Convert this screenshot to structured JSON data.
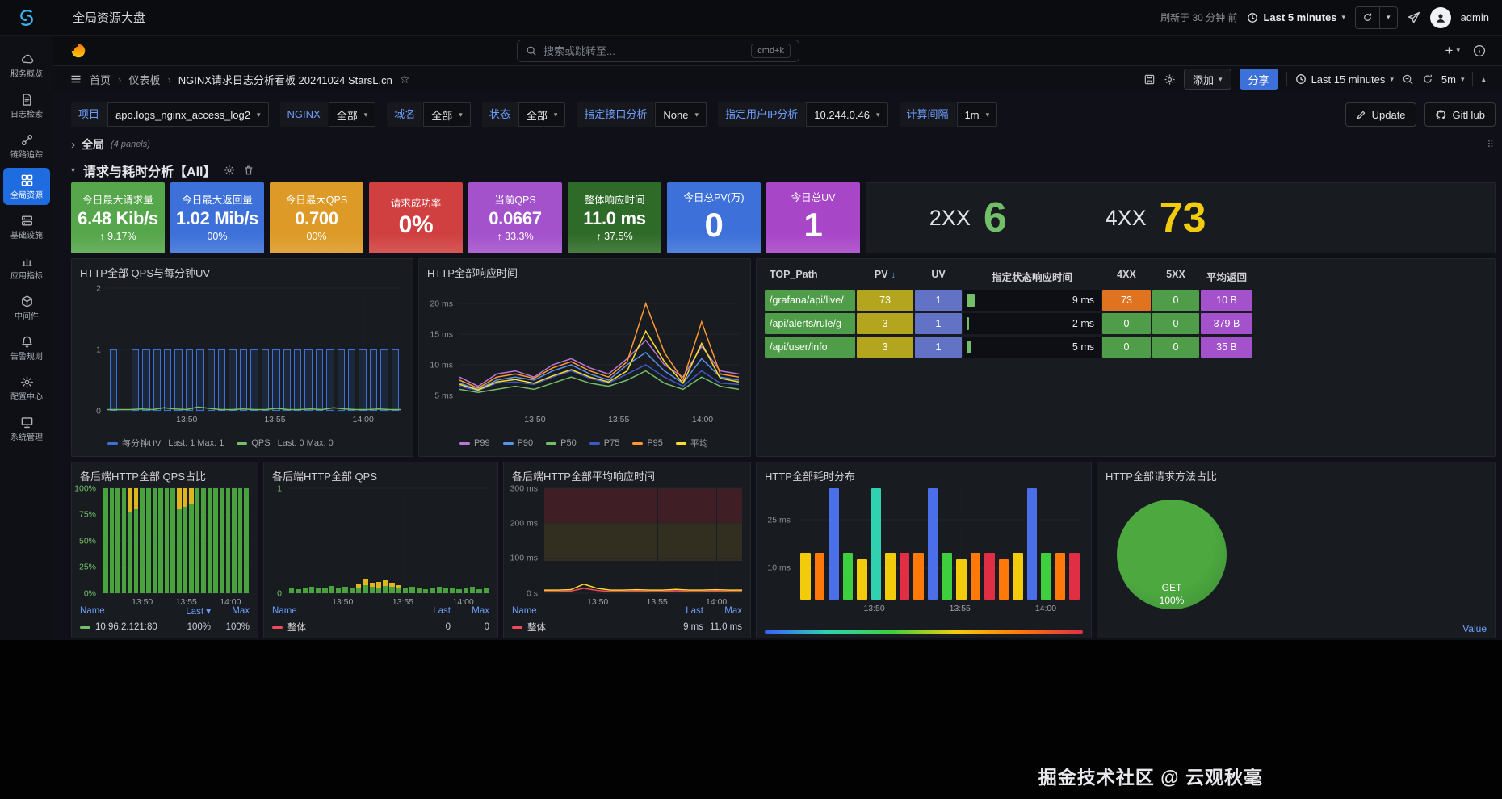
{
  "topbar": {
    "title": "全局资源大盘",
    "refreshed_note": "刷新于 30 分钟 前",
    "time_range": "Last 5 minutes",
    "user": "admin"
  },
  "sidebar": {
    "active_color": "#1f6be0",
    "items": [
      {
        "id": "service-overview",
        "label": "服务概览",
        "icon": "cloud-icon"
      },
      {
        "id": "log-search",
        "label": "日志检索",
        "icon": "log-doc-icon"
      },
      {
        "id": "trace",
        "label": "链路追踪",
        "icon": "trace-icon"
      },
      {
        "id": "global-resource",
        "label": "全局资源",
        "icon": "dashboard-icon",
        "active": true
      },
      {
        "id": "infrastructure",
        "label": "基础设施",
        "icon": "server-icon"
      },
      {
        "id": "app-metrics",
        "label": "应用指标",
        "icon": "metrics-icon"
      },
      {
        "id": "middleware",
        "label": "中间件",
        "icon": "cube-icon"
      },
      {
        "id": "alert-rules",
        "label": "告警规则",
        "icon": "bell-icon"
      },
      {
        "id": "config-center",
        "label": "配置中心",
        "icon": "gear-icon"
      },
      {
        "id": "system-admin",
        "label": "系统管理",
        "icon": "monitor-icon"
      }
    ]
  },
  "grafana_nav": {
    "search_placeholder": "搜索或跳转至...",
    "shortcut": "cmd+k"
  },
  "breadcrumbs": {
    "home": "首页",
    "section": "仪表板",
    "page": "NGINX请求日志分析看板 20241024 StarsL.cn"
  },
  "toolbar": {
    "add_label": "添加",
    "share_label": "分享",
    "time_range": "Last 15 minutes",
    "refresh_interval": "5m"
  },
  "filters": {
    "items": [
      {
        "label": "项目",
        "value": "apo.logs_nginx_access_log2"
      },
      {
        "label": "NGINX",
        "value": "全部"
      },
      {
        "label": "域名",
        "value": "全部"
      },
      {
        "label": "状态",
        "value": "全部"
      },
      {
        "label": "指定接口分析",
        "value": "None"
      },
      {
        "label": "指定用户IP分析",
        "value": "10.244.0.46"
      },
      {
        "label": "计算间隔",
        "value": "1m"
      }
    ],
    "update_label": "Update",
    "github_label": "GitHub"
  },
  "rows": {
    "global_title": "全局",
    "global_note": "(4 panels)",
    "section_title": "请求与耗时分析【All】"
  },
  "stats": [
    {
      "title": "今日最大请求量",
      "value": "6.48 Kib/s",
      "delta": "↑ 9.17%",
      "bg": "#56a64b"
    },
    {
      "title": "今日最大返回量",
      "value": "1.02 Mib/s",
      "delta": "00%",
      "bg": "#3d71d9"
    },
    {
      "title": "今日最大QPS",
      "value": "0.700",
      "delta": "00%",
      "bg": "#dd9a26"
    },
    {
      "title": "请求成功率",
      "value": "0%",
      "size": "lg",
      "bg": "#d04040"
    },
    {
      "title": "当前QPS",
      "value": "0.0667",
      "delta": "↑ 33.3%",
      "bg": "#a352cc"
    },
    {
      "title": "整体响应时间",
      "value": "11.0 ms",
      "delta": "↑ 37.5%",
      "bg": "#2f6b28"
    },
    {
      "title": "今日总PV(万)",
      "value": "0",
      "size": "big",
      "bg": "#3d71d9"
    },
    {
      "title": "今日总UV",
      "value": "1",
      "size": "big",
      "bg": "#a846c8"
    }
  ],
  "status_stats": [
    {
      "label": "2XX",
      "value": "6",
      "color": "#73bf69"
    },
    {
      "label": "4XX",
      "value": "73",
      "color": "#f2cc0c"
    }
  ],
  "charts": {
    "qps_uv": {
      "title": "HTTP全部 QPS与每分钟UV",
      "ymax": 2,
      "y_grid": [
        {
          "f": 0,
          "label": "0"
        },
        {
          "f": 0.5,
          "label": "1"
        },
        {
          "f": 1,
          "label": "2"
        }
      ],
      "x_grid": [
        {
          "f": 0.27,
          "label": "13:50"
        },
        {
          "f": 0.57,
          "label": "13:55"
        },
        {
          "f": 0.87,
          "label": "14:00"
        }
      ],
      "bar_color": "#3d71d9",
      "bars": [
        1,
        0,
        1,
        1,
        1,
        1,
        1,
        1,
        1,
        1,
        1,
        1,
        1,
        1,
        1,
        1,
        1,
        1,
        1,
        1,
        1,
        1,
        1,
        1,
        1,
        1,
        1
      ],
      "line_color": "#73bf69",
      "line": [
        0.02,
        0.02,
        0.02,
        0.03,
        0.02,
        0.05,
        0.03,
        0.02,
        0.06,
        0.04,
        0.02,
        0.02,
        0.03,
        0.02,
        0.02,
        0.04,
        0.02,
        0.02,
        0.03,
        0.02,
        0.05,
        0.03,
        0.02,
        0.02,
        0.03,
        0.02,
        0.02
      ],
      "legend": [
        {
          "label": "每分钟UV",
          "color": "#3d71d9",
          "stats": "Last: 1   Max: 1"
        },
        {
          "label": "QPS",
          "color": "#73bf69",
          "stats": "Last: 0   Max: 0"
        }
      ]
    },
    "resp_time": {
      "title": "HTTP全部响应时间",
      "ymin": 2.5,
      "ymax": 22.5,
      "y_grid": [
        {
          "f": 0.125,
          "label": "5 ms"
        },
        {
          "f": 0.375,
          "label": "10 ms"
        },
        {
          "f": 0.625,
          "label": "15 ms"
        },
        {
          "f": 0.875,
          "label": "20 ms"
        }
      ],
      "x_grid": [
        {
          "f": 0.27,
          "label": "13:50"
        },
        {
          "f": 0.57,
          "label": "13:55"
        },
        {
          "f": 0.87,
          "label": "14:00"
        }
      ],
      "series": [
        {
          "name": "P99",
          "color": "#b877d9",
          "values": [
            8,
            6.5,
            8.5,
            9,
            8,
            10,
            11,
            9.5,
            8.5,
            11,
            14,
            10,
            8,
            13,
            9,
            8.5
          ]
        },
        {
          "name": "P90",
          "color": "#5794f2",
          "values": [
            7,
            6,
            7.5,
            8,
            7.5,
            9,
            10,
            8.5,
            7.5,
            10,
            12,
            9,
            7,
            11,
            8,
            7.5
          ]
        },
        {
          "name": "P50",
          "color": "#73bf69",
          "values": [
            6,
            5.5,
            6,
            6.5,
            6,
            7,
            8,
            7,
            6.5,
            7.5,
            9,
            7,
            6,
            8,
            6.5,
            6
          ]
        },
        {
          "name": "P75",
          "color": "#3d58c9",
          "values": [
            6.5,
            5.8,
            7,
            7.2,
            6.8,
            8,
            9,
            7.8,
            7,
            8.5,
            10,
            8,
            6.5,
            9,
            7,
            6.8
          ]
        },
        {
          "name": "P95",
          "color": "#ff9830",
          "values": [
            7.5,
            6.2,
            8,
            8.5,
            7.8,
            9.5,
            10.5,
            9,
            8,
            10.5,
            20,
            12,
            7.5,
            17,
            8.5,
            8
          ]
        },
        {
          "name": "平均",
          "color": "#fade2a",
          "values": [
            6.8,
            5.9,
            7.2,
            7.6,
            7,
            8.2,
            9.2,
            8,
            7.2,
            9,
            15.5,
            10.5,
            7,
            13.5,
            7.8,
            7.2
          ]
        }
      ]
    },
    "top_table": {
      "headers": [
        "TOP_Path",
        "PV",
        "UV",
        "指定状态响应时间",
        "4XX",
        "5XX",
        "平均返回"
      ],
      "sorted_by": "PV",
      "path_bg": "#4f9d48",
      "pv_bg": "#b3a51d",
      "uv_bg": "#6272c4",
      "avg_bg": "#a352cc",
      "ok_bg": "#4f9d48",
      "warn_bg": "#e0731f",
      "gauge_color": "#73bf69",
      "rows": [
        {
          "path": "/grafana/api/live/",
          "pv": "73",
          "uv": "1",
          "resp": "9 ms",
          "resp_f": 0.06,
          "xx4": "73",
          "xx4_warn": true,
          "xx5": "0",
          "avg": "10 B"
        },
        {
          "path": "/api/alerts/rule/g",
          "pv": "3",
          "uv": "1",
          "resp": "2 ms",
          "resp_f": 0.02,
          "xx4": "0",
          "xx4_warn": false,
          "xx5": "0",
          "avg": "379 B"
        },
        {
          "path": "/api/user/info",
          "pv": "3",
          "uv": "1",
          "resp": "5 ms",
          "resp_f": 0.035,
          "xx4": "0",
          "xx4_warn": false,
          "xx5": "0",
          "avg": "35 B"
        }
      ]
    },
    "backend_ratio": {
      "title": "各后端HTTP全部 QPS占比",
      "axis_color": "#73bf69",
      "y_grid": [
        {
          "f": 0,
          "label": "0%"
        },
        {
          "f": 0.25,
          "label": "25%"
        },
        {
          "f": 0.5,
          "label": "50%"
        },
        {
          "f": 0.75,
          "label": "75%"
        },
        {
          "f": 1,
          "label": "100%"
        }
      ],
      "x_grid": [
        {
          "f": 0.27,
          "label": "13:50"
        },
        {
          "f": 0.57,
          "label": "13:55"
        },
        {
          "f": 0.87,
          "label": "14:00"
        }
      ],
      "green_color": "#4aa23f",
      "yellow_color": "#ddb620",
      "yellow": [
        0,
        0,
        0,
        0,
        0.22,
        0.2,
        0,
        0,
        0,
        0,
        0,
        0,
        0.2,
        0.18,
        0.15,
        0,
        0,
        0,
        0,
        0,
        0,
        0,
        0,
        0
      ],
      "table": {
        "headers": [
          "Name",
          "Last",
          "Max"
        ],
        "sorted": "Last",
        "rows": [
          {
            "name": "10.96.2.121:80",
            "color": "#73bf69",
            "last": "100%",
            "max": "100%"
          }
        ]
      }
    },
    "backend_qps": {
      "title": "各后端HTTP全部 QPS",
      "axis_color": "#73bf69",
      "y_grid": [
        {
          "f": 0,
          "label": "0"
        },
        {
          "f": 1,
          "label": "1"
        }
      ],
      "x_grid": [
        {
          "f": 0.27,
          "label": "13:50"
        },
        {
          "f": 0.57,
          "label": "13:55"
        },
        {
          "f": 0.87,
          "label": "14:00"
        }
      ],
      "green_color": "#4aa23f",
      "yellow_color": "#ddb620",
      "green": [
        0.05,
        0.04,
        0.05,
        0.06,
        0.05,
        0.05,
        0.07,
        0.05,
        0.06,
        0.05,
        0.05,
        0.08,
        0.06,
        0.05,
        0.07,
        0.06,
        0.05,
        0.05,
        0.06,
        0.05,
        0.04,
        0.05,
        0.06,
        0.05,
        0.05,
        0.04,
        0.05,
        0.06,
        0.04,
        0.05
      ],
      "yellow": [
        0,
        0,
        0,
        0,
        0,
        0,
        0,
        0,
        0,
        0,
        0.04,
        0.05,
        0.04,
        0.06,
        0.05,
        0.04,
        0.03,
        0,
        0,
        0,
        0,
        0,
        0,
        0,
        0,
        0,
        0,
        0,
        0,
        0
      ],
      "table": {
        "headers": [
          "Name",
          "Last",
          "Max"
        ],
        "rows": [
          {
            "name": "整体",
            "color": "#f2495c",
            "last": "0",
            "max": "0"
          }
        ]
      }
    },
    "backend_latency": {
      "title": "各后端HTTP全部平均响应时间",
      "ymin": 0,
      "ymax": 300,
      "y_grid": [
        {
          "f": 0,
          "label": "0 s"
        },
        {
          "f": 0.333,
          "label": "100 ms"
        },
        {
          "f": 0.667,
          "label": "200 ms"
        },
        {
          "f": 1,
          "label": "300 ms"
        }
      ],
      "x_grid": [
        {
          "f": 0.27,
          "label": "13:50"
        },
        {
          "f": 0.57,
          "label": "13:55"
        },
        {
          "f": 0.87,
          "label": "14:00"
        }
      ],
      "bands": [
        {
          "from": 0.31,
          "to": 0.667,
          "color": "rgba(186,148,38,0.16)"
        },
        {
          "from": 0.667,
          "to": 1,
          "color": "rgba(224,47,68,0.2)"
        }
      ],
      "series": [
        {
          "name": "平均",
          "color": "#fade2a",
          "values": [
            9,
            9,
            10,
            26,
            14,
            9,
            9,
            10,
            9,
            9,
            11,
            9,
            9,
            10,
            9,
            9
          ]
        },
        {
          "name": "整体",
          "color": "#f2495c",
          "values": [
            5,
            5,
            6,
            14,
            8,
            5,
            5,
            6,
            5,
            5,
            7,
            5,
            5,
            6,
            5,
            5
          ]
        }
      ],
      "table": {
        "headers": [
          "Name",
          "Last",
          "Max"
        ],
        "rows": [
          {
            "name": "整体",
            "color": "#f2495c",
            "last": "9 ms",
            "max": "11.0 ms"
          }
        ]
      }
    },
    "latency_dist": {
      "title": "HTTP全部耗时分布",
      "y_grid": [
        {
          "f": 0.285,
          "label": "10 ms"
        },
        {
          "f": 0.715,
          "label": "25 ms"
        }
      ],
      "x_grid": [
        {
          "f": 0.27,
          "label": "13:50"
        },
        {
          "f": 0.57,
          "label": "13:55"
        },
        {
          "f": 0.87,
          "label": "14:00"
        }
      ],
      "cells": [
        {
          "c": "#f2cc0c",
          "h": 0.42
        },
        {
          "c": "#ff780a",
          "h": 0.42
        },
        {
          "c": "#4a6fe8",
          "h": 1
        },
        {
          "c": "#3ecf3e",
          "h": 0.42
        },
        {
          "c": "#f2cc0c",
          "h": 0.36
        },
        {
          "c": "#2fd1b0",
          "h": 1
        },
        {
          "c": "#f2cc0c",
          "h": 0.42
        },
        {
          "c": "#e02f44",
          "h": 0.42
        },
        {
          "c": "#ff780a",
          "h": 0.42
        },
        {
          "c": "#4a6fe8",
          "h": 1
        },
        {
          "c": "#3ecf3e",
          "h": 0.42
        },
        {
          "c": "#f2cc0c",
          "h": 0.36
        },
        {
          "c": "#ff780a",
          "h": 0.42
        },
        {
          "c": "#e02f44",
          "h": 0.42
        },
        {
          "c": "#ff780a",
          "h": 0.36
        },
        {
          "c": "#f2cc0c",
          "h": 0.42
        },
        {
          "c": "#4a6fe8",
          "h": 1
        },
        {
          "c": "#3ecf3e",
          "h": 0.42
        },
        {
          "c": "#ff780a",
          "h": 0.42
        },
        {
          "c": "#e02f44",
          "h": 0.42
        }
      ],
      "gradient": [
        "#3861fb",
        "#2fd1b0",
        "#3ecf3e",
        "#f2cc0c",
        "#ff780a",
        "#e02f44"
      ]
    },
    "method_pie": {
      "title": "HTTP全部请求方法占比",
      "color": "#4ca83f",
      "slices": [
        {
          "label": "GET",
          "value": "100%",
          "color": "#4ca83f"
        }
      ],
      "legend_header": "Value"
    }
  },
  "watermark": "掘金技术社区 @ 云观秋毫",
  "glyphs": {
    "caret": "▾",
    "star": "☆",
    "sort_down": "↓",
    "chevron_right": "›",
    "chevron_down": "▾",
    "collapse": "▴",
    "drag": "⠿",
    "plus": "+"
  }
}
